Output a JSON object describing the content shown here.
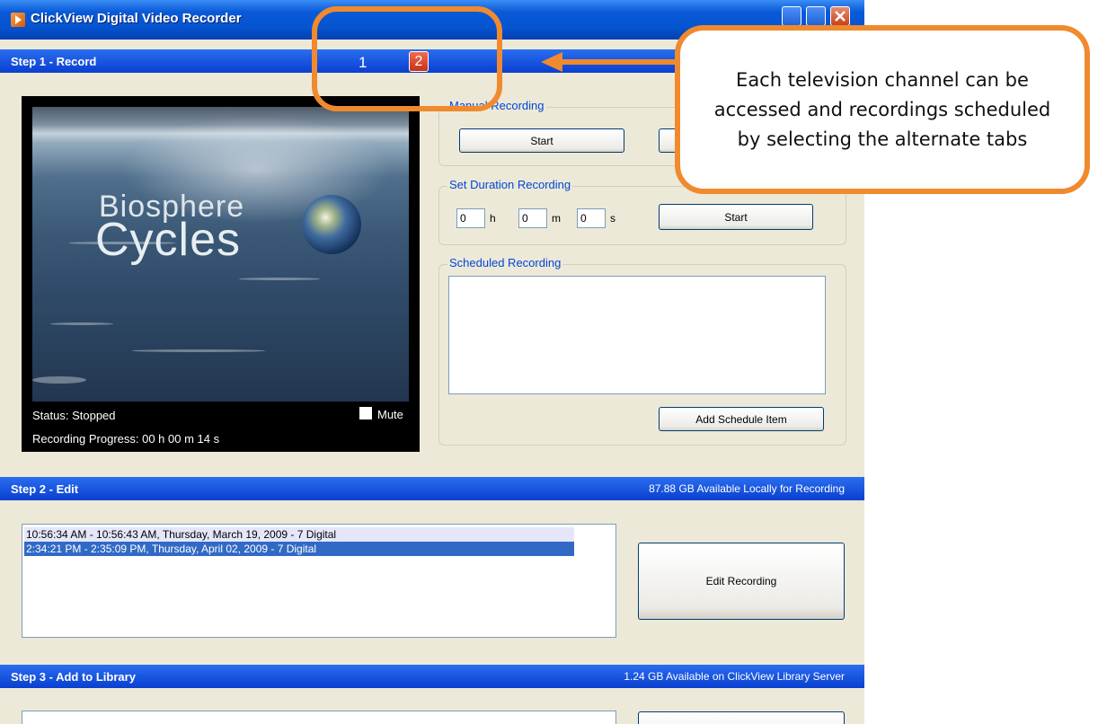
{
  "window": {
    "title": "ClickView Digital Video Recorder"
  },
  "step1": {
    "title": "Step 1 - Record",
    "tabs": [
      "1",
      "2"
    ],
    "video": {
      "overlay_line1": "Biosphere",
      "overlay_line2": "Cycles",
      "status": "Status: Stopped",
      "progress": "Recording Progress: 00  h  00  m  14  s",
      "mute_label": "Mute",
      "mute_checked": false
    },
    "manual": {
      "label": "Manual Recording",
      "start_label": "Start"
    },
    "duration": {
      "label": "Set Duration Recording",
      "hours": "0",
      "hours_unit": "h",
      "minutes": "0",
      "minutes_unit": "m",
      "seconds": "0",
      "seconds_unit": "s",
      "start_label": "Start"
    },
    "scheduled": {
      "label": "Scheduled Recording",
      "items": [],
      "add_label": "Add Schedule Item"
    }
  },
  "step2": {
    "title": "Step 2 - Edit",
    "info": "87.88 GB Available Locally for Recording",
    "recordings": [
      "10:56:34 AM - 10:56:43 AM, Thursday, March 19, 2009 - 7 Digital",
      "2:34:21 PM - 2:35:09 PM, Thursday, April 02, 2009 - 7 Digital"
    ],
    "selected_index": 1,
    "edit_label": "Edit Recording"
  },
  "step3": {
    "title": "Step 3 - Add to Library",
    "info": "1.24 GB Available on ClickView Library Server"
  },
  "callout": {
    "line1": "Each television channel can be",
    "line2": "accessed and recordings scheduled",
    "line3": "by selecting the alternate tabs"
  },
  "colors": {
    "accent": "#f08a2e",
    "step_bar": "#0a3fd0",
    "selection": "#316ac5",
    "hover_row": "#e6e6fa"
  }
}
